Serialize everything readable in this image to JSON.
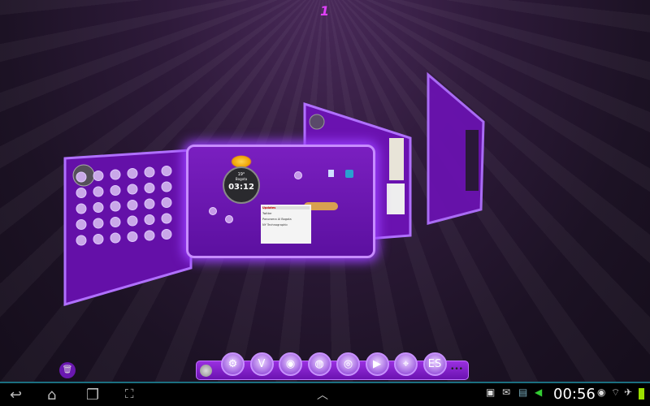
{
  "page_indicator": "1",
  "center_screen": {
    "clock_time": "03:12",
    "temperature": "19°",
    "city": "Bogota",
    "notifications_title": "Updates",
    "notifications": [
      "Twitter",
      "Panorama Al Bogota",
      "NY Technographic"
    ]
  },
  "dock": {
    "apps": [
      {
        "name": "Settings",
        "icon": "gear-icon",
        "glyph": "⚙"
      },
      {
        "name": "VNC",
        "icon": "vnc-icon",
        "glyph": "V"
      },
      {
        "name": "Camera",
        "icon": "camera-icon",
        "glyph": "◉"
      },
      {
        "name": "Browser",
        "icon": "globe-icon",
        "glyph": "◍"
      },
      {
        "name": "Chrome",
        "icon": "chrome-icon",
        "glyph": "◎"
      },
      {
        "name": "Play Store",
        "icon": "play-store-icon",
        "glyph": "▶"
      },
      {
        "name": "Maps",
        "icon": "maps-icon",
        "glyph": "⌖"
      },
      {
        "name": "ES File Explorer",
        "icon": "folder-icon",
        "glyph": "ES"
      }
    ],
    "more": "•••"
  },
  "statusbar": {
    "time": "00:56"
  },
  "colors": {
    "accent": "#9b40ff",
    "navbar_line": "#1b6f80",
    "battery": "#9be000"
  }
}
